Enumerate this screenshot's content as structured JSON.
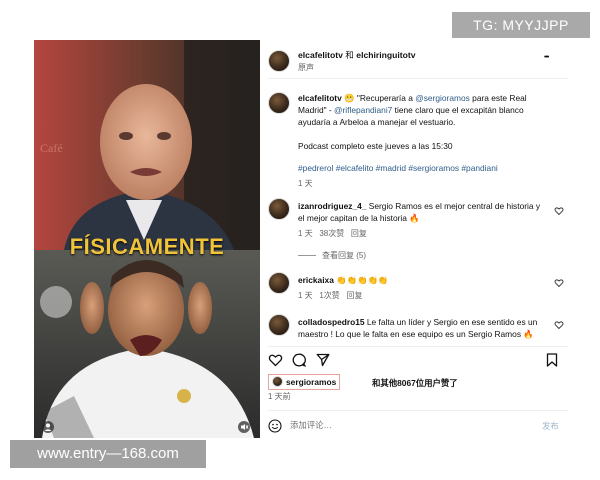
{
  "watermark_tl": "TG: MYYJJPP",
  "watermark_bl": "www.entry—168.com",
  "media": {
    "overlay_title": "FÍSICAMENTE"
  },
  "header": {
    "author": "elcafelitotv",
    "and_text": "和",
    "coauthor": "elchiringuitotv",
    "subtitle": "原声",
    "more_label": "•••"
  },
  "caption": {
    "author": "elcafelitotv",
    "emoji": "😬",
    "text1": " \"Recuperaría a ",
    "mention1": "@sergioramos",
    "text2": " para este Real Madrid\" - ",
    "mention2": "@riflepandiani7",
    "text3": " tiene claro que el excapitán blanco ayudaría a Arbeloa a manejar el vestuario.",
    "podcast": "Podcast completo este jueves a las 15:30",
    "hashtags": "#pedrerol #elcafelito #madrid #sergioramos #pandiani",
    "time": "1 天"
  },
  "comments": [
    {
      "user": "izanrodriguez_4_",
      "text": " Sergio Ramos es el mejor central de historia y el mejor capitan de la historia 🔥",
      "time": "1 天",
      "likes": "38次赞",
      "reply": "回复",
      "view_replies": "查看回复 (5)"
    },
    {
      "user": "erickaixa",
      "text": " 👏👏👏👏👏",
      "time": "1 天",
      "likes": "1次赞",
      "reply": "回复"
    },
    {
      "user": "colladospedro15",
      "text": " Le falta un líder y Sergio en ese sentido es un maestro ! Lo que le falta en ese equipo es un Sergio Ramos 🔥"
    }
  ],
  "likes": {
    "user": "sergioramos",
    "rest": "和其他8067位用户赞了"
  },
  "post_time": "1 天前",
  "comment_box": {
    "placeholder": "添加评论…",
    "post_label": "发布"
  },
  "colors": {
    "mention": "#2f5d8a",
    "hashtag": "#2f5d8a",
    "title_yellow": "#f1c33b",
    "post_button": "#9fb6cc"
  }
}
